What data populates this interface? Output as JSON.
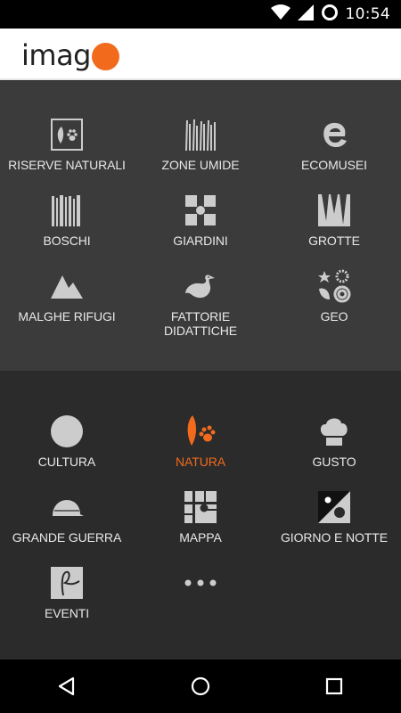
{
  "status_bar": {
    "time": "10:54"
  },
  "header": {
    "logo_text": "imag"
  },
  "primary_categories": [
    {
      "label": "RISERVE NATURALI",
      "icon": "reserve-icon"
    },
    {
      "label": "ZONE UMIDE",
      "icon": "wetland-reeds-icon"
    },
    {
      "label": "ECOMUSEI",
      "icon": "ecomuseum-icon"
    },
    {
      "label": "BOSCHI",
      "icon": "forest-icon"
    },
    {
      "label": "GIARDINI",
      "icon": "garden-icon"
    },
    {
      "label": "GROTTE",
      "icon": "cave-icon"
    },
    {
      "label": "MALGHE RIFUGI",
      "icon": "mountain-icon"
    },
    {
      "label": "FATTORIE\nDIDATTICHE",
      "icon": "farm-goose-icon"
    },
    {
      "label": "GEO",
      "icon": "geo-icon"
    }
  ],
  "sections": [
    {
      "label": "CULTURA",
      "icon": "culture-icon",
      "active": false
    },
    {
      "label": "NATURA",
      "icon": "nature-leaf-paw-icon",
      "active": true
    },
    {
      "label": "GUSTO",
      "icon": "chef-hat-icon",
      "active": false
    },
    {
      "label": "GRANDE GUERRA",
      "icon": "helmet-icon",
      "active": false
    },
    {
      "label": "MAPPA",
      "icon": "map-icon",
      "active": false
    },
    {
      "label": "GIORNO E NOTTE",
      "icon": "day-night-icon",
      "active": false
    },
    {
      "label": "EVENTI",
      "icon": "events-icon",
      "active": false
    },
    {
      "label": "",
      "icon": "more-dots-icon",
      "active": false
    }
  ],
  "colors": {
    "accent": "#f26b1d",
    "panel_top": "#3b3b3b",
    "panel_bottom": "#2b2b2b"
  }
}
